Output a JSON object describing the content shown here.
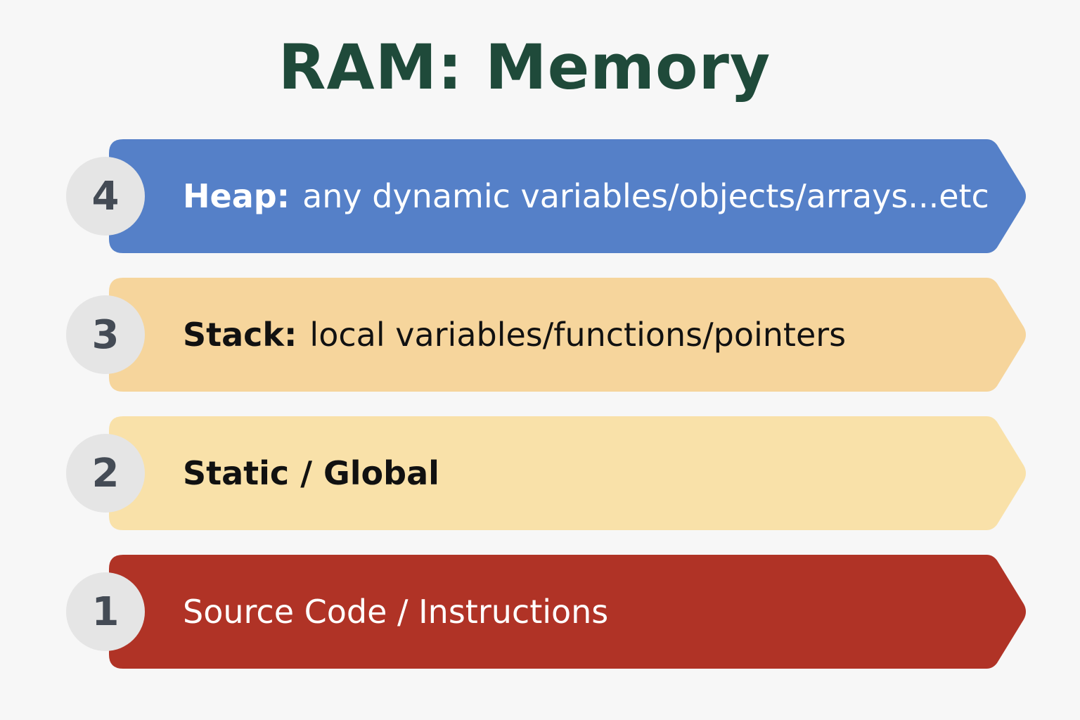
{
  "title": "RAM: Memory",
  "colors": {
    "title": "#1f4a3a",
    "badge_bg": "#e5e5e5",
    "badge_text": "#444b55"
  },
  "segments": [
    {
      "number": "4",
      "term": "Heap:",
      "desc": "any dynamic variables/objects/arrays...etc",
      "fill": "#5580c8",
      "text_color": "#ffffff"
    },
    {
      "number": "3",
      "term": "Stack:",
      "desc": "local variables/functions/pointers",
      "fill": "#f6d59c",
      "text_color": "#111111"
    },
    {
      "number": "2",
      "term": "Static / Global",
      "desc": "",
      "fill": "#f9e1a9",
      "text_color": "#111111"
    },
    {
      "number": "1",
      "term": "Source Code / Instructions",
      "desc": "",
      "fill": "#b03326",
      "text_color": "#ffffff"
    }
  ]
}
